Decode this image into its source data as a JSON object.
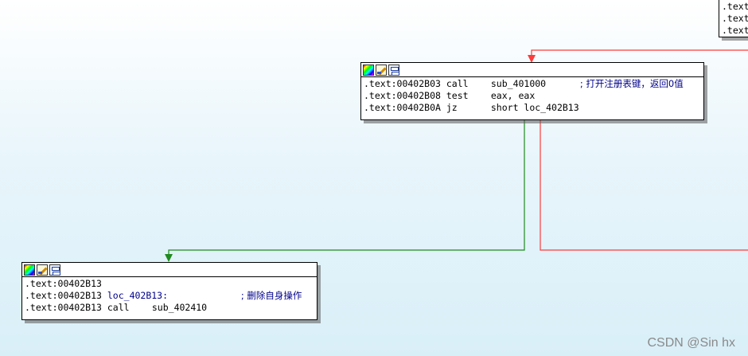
{
  "colors": {
    "edge_false": "#ff3b3b",
    "edge_true": "#1f8a1f",
    "comment": "#00008b"
  },
  "icons": [
    "color-palette-icon",
    "edit-pencil-icon",
    "graph-view-icon"
  ],
  "nodes": {
    "top_right": {
      "lines": [
        ".text",
        ".text",
        ".text"
      ]
    },
    "middle": {
      "lines": [
        {
          "addr": ".text:00402B03",
          "label": "",
          "mnemonic": "call",
          "operand": "sub_401000",
          "comment": "; 打开注册表键，返回0值"
        },
        {
          "addr": ".text:00402B08",
          "label": "",
          "mnemonic": "test",
          "operand": "eax, eax",
          "comment": ""
        },
        {
          "addr": ".text:00402B0A",
          "label": "",
          "mnemonic": "jz",
          "operand": "short loc_402B13",
          "comment": ""
        }
      ]
    },
    "bottom": {
      "lines": [
        {
          "addr": ".text:00402B13",
          "label": "",
          "mnemonic": "",
          "operand": "",
          "comment": ""
        },
        {
          "addr": ".text:00402B13",
          "label": "loc_402B13:",
          "mnemonic": "",
          "operand": "",
          "comment": "; 删除自身操作"
        },
        {
          "addr": ".text:00402B13",
          "label": "",
          "mnemonic": "call",
          "operand": "sub_402410",
          "comment": ""
        }
      ]
    }
  },
  "watermark": "CSDN @Sin hx"
}
